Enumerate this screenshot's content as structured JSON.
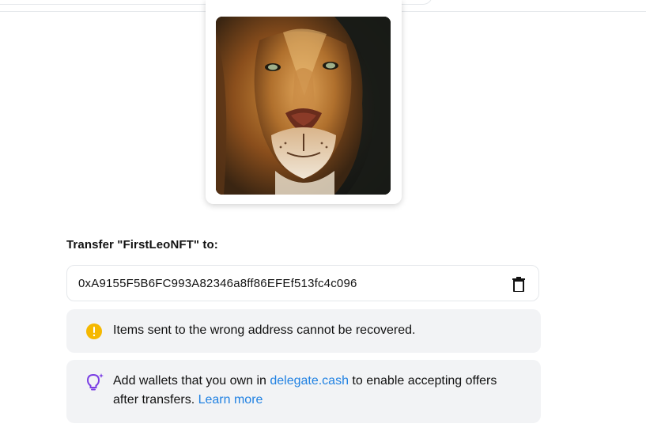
{
  "nft": {
    "image_alt": "Lion portrait NFT image"
  },
  "transfer": {
    "label": "Transfer \"FirstLeoNFT\" to:",
    "address_value": "0xA9155F5B6FC993A82346a8ff86EFEf513fc4c096",
    "address_placeholder": ""
  },
  "warning": {
    "text": "Items sent to the wrong address cannot be recovered.",
    "icon": "exclamation-circle-icon",
    "icon_color": "#f5b800"
  },
  "info": {
    "text_before": "Add wallets that you own in ",
    "link_delegate": "delegate.cash",
    "text_middle": " to enable accepting offers after transfers. ",
    "link_learn_more": "Learn more",
    "icon": "lightbulb-icon",
    "icon_color": "#7b3fe4"
  },
  "colors": {
    "link": "#2081e2",
    "notice_bg": "#f2f3f5",
    "border": "#e5e8eb"
  }
}
